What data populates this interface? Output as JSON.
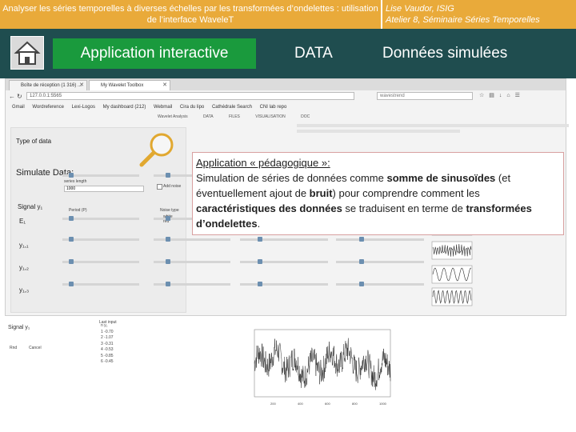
{
  "header": {
    "title": "Analyser les séries temporelles à diverses échelles par les transformées d’ondelettes : utilisation de l’interface WaveleT",
    "author": "Lise Vaudor, ISIG",
    "event": "Atelier 8, Séminaire Séries Temporelles"
  },
  "nav": {
    "home_icon": "home-icon",
    "items": [
      "Application interactive",
      "DATA",
      "Données simulées"
    ]
  },
  "colors": {
    "header_bg": "#e9aa3a",
    "nav_bg": "#1f4d4f",
    "active_nav": "#1a9a3d",
    "series": "#2c2c2c"
  },
  "browser": {
    "tabs": [
      "Boîte de réception (1 316) ...",
      "My Wavelet Toolbox"
    ],
    "url": "127.0.0.1:5565",
    "search_placeholder": "wavestrend",
    "bookmarks": [
      "Gmail",
      "Wordreference",
      "Lexi-Logos",
      "My dashboard (212)",
      "Webmail",
      "Cira du lipo",
      "Cathédrale Search",
      "CNI lab repo"
    ],
    "app_tabs": [
      "Wavelet Analysis",
      "DATA",
      "FILES",
      "VISUALISATION",
      "DOC"
    ]
  },
  "app": {
    "type_of_data": "Type of data",
    "simulate_data": "Simulate Data:",
    "series_length": "series length",
    "series_length_value": "1000",
    "add_noise": "Add noise",
    "signal_label": "Signal y₁",
    "y_labels": [
      "y₁,₁",
      "y₁,₂",
      "y₁,₃"
    ],
    "e_label": "E₁",
    "col_labels": [
      "Period (P)",
      "Noise type"
    ],
    "noise_options": [
      "white",
      "red"
    ],
    "bottom_signal": "Signal y₁",
    "bottom_table": "Last input",
    "bottom_buttons": [
      "Rnd",
      "Cancel"
    ],
    "table_header": [
      "n",
      "y₁"
    ],
    "table_rows": [
      [
        "1",
        "-0.70"
      ],
      [
        "2",
        "-1.07"
      ],
      [
        "3",
        "-0.31"
      ],
      [
        "4",
        "-0.53"
      ],
      [
        "5",
        "-0.85"
      ],
      [
        "6",
        "-0.45"
      ]
    ],
    "x_ticks": [
      "200",
      "400",
      "600",
      "800",
      "1000"
    ]
  },
  "callout": {
    "head": "Application « pédagogique »:",
    "p1": "Simulation de séries de données comme ",
    "b1": "somme de sinusoïdes",
    "p2": " (et éventuellement ajout de ",
    "b2": "bruit",
    "p3": ") pour comprendre comment les ",
    "b3": "caractéristiques des données",
    "p4": " se traduisent en terme de ",
    "b4": "transformées d’ondelettes",
    "p5": "."
  }
}
